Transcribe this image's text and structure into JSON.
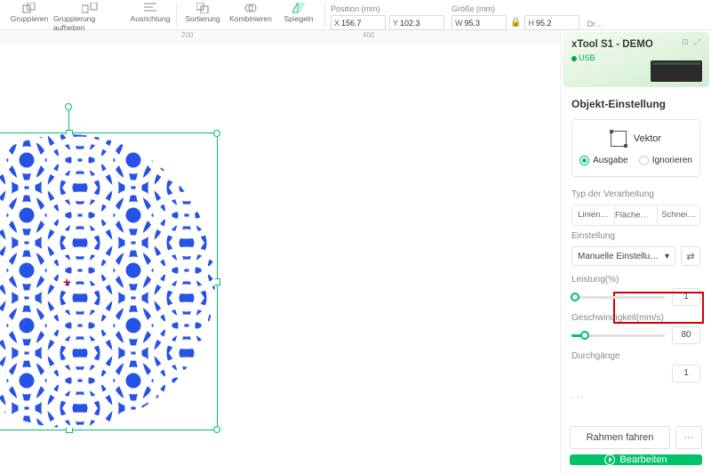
{
  "toolbar": {
    "group": "Gruppieren",
    "ungroup": "Gruppierung aufheben",
    "align": "Ausrichtung",
    "sort": "Sortierung",
    "combine": "Kombinieren",
    "mirror": "Spiegeln"
  },
  "props": {
    "position_label": "Position (mm)",
    "size_label": "Größe (mm)",
    "rotation_label": "Dr…",
    "x_prefix": "X",
    "y_prefix": "Y",
    "w_prefix": "W",
    "h_prefix": "H",
    "x": "156.7",
    "y": "102.3",
    "w": "95.3",
    "h": "95.2"
  },
  "ruler": {
    "t200": "200",
    "t400": "400"
  },
  "device": {
    "name": "xTool S1 - DEMO",
    "conn": "USB"
  },
  "settings": {
    "title": "Objekt-Einstellung",
    "vector": "Vektor",
    "output": "Ausgabe",
    "ignore": "Ignorieren",
    "processing_type": "Typ der Verarbeitung",
    "seg_line": "Linien…",
    "seg_area": "Fläche…",
    "seg_cut": "Schnei…",
    "setting": "Einstellung",
    "manual": "Manuelle Einstellu…",
    "power_label": "Leistung(%)",
    "power_value": "1",
    "speed_label": "Geschwindigkeit(mm/s)",
    "speed_value": "80",
    "pass_label": "Durchgänge",
    "pass_value": "1"
  },
  "footer": {
    "frame": "Rahmen fahren",
    "more": "···",
    "process": "Bearbeiten"
  }
}
